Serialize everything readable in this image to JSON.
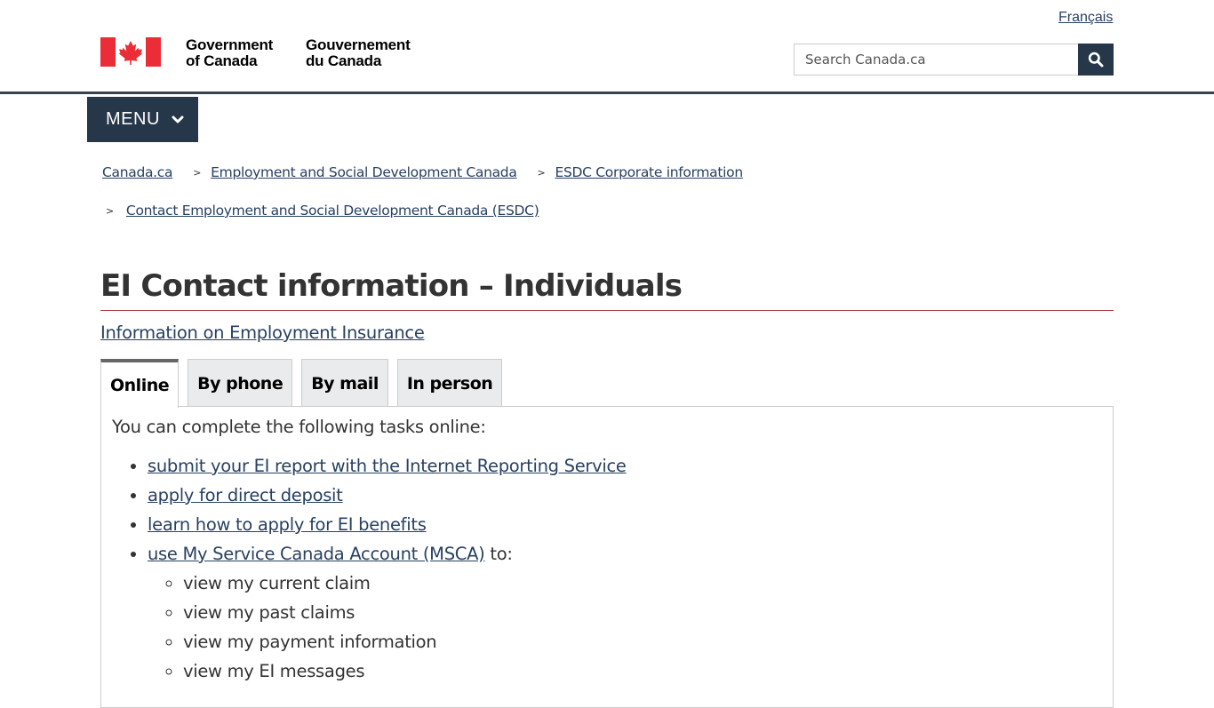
{
  "header": {
    "language_link": "Français",
    "logo": {
      "en_line1": "Government",
      "en_line2": "of Canada",
      "fr_line1": "Gouvernement",
      "fr_line2": "du Canada"
    },
    "search": {
      "placeholder": "Search Canada.ca"
    }
  },
  "menu": {
    "label": "MENU"
  },
  "breadcrumb": {
    "items": [
      "Canada.ca",
      "Employment and Social Development Canada",
      "ESDC Corporate information",
      "Contact Employment and Social Development Canada (ESDC)"
    ],
    "separator": ">"
  },
  "page": {
    "title": "EI Contact information – Individuals",
    "intro_link": "Information on Employment Insurance"
  },
  "tabs": [
    {
      "label": "Online",
      "active": true
    },
    {
      "label": "By phone",
      "active": false
    },
    {
      "label": "By mail",
      "active": false
    },
    {
      "label": "In person",
      "active": false
    }
  ],
  "panel": {
    "intro": "You can complete the following tasks online:",
    "tasks": [
      "submit your EI report with the Internet Reporting Service",
      "apply for direct deposit",
      "learn how to apply for EI benefits"
    ],
    "msca": {
      "link": "use My Service Canada Account (MSCA)",
      "suffix": " to:",
      "subtasks": [
        "view my current claim",
        "view my past claims",
        "view my payment information",
        "view my EI messages"
      ]
    }
  },
  "colors": {
    "brand_dark": "#26374a",
    "link": "#284162",
    "flag_red": "#eb2d37",
    "title_rule": "#af3c43"
  }
}
